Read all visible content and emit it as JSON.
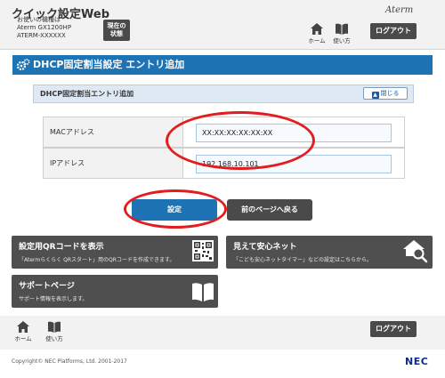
{
  "header": {
    "app_title": "クイック設定Web",
    "device_caption": "お使いの機種は",
    "device_model": "Aterm GX1200HP",
    "device_id": "ATERM-XXXXXX",
    "status_button": "現在の\n状態",
    "brand": "Aterm",
    "home_label": "ホーム",
    "help_label": "使い方",
    "logout_label": "ログアウト"
  },
  "page": {
    "title": "DHCP固定割当設定 エントリ追加"
  },
  "section": {
    "title": "DHCP固定割当エントリ追加",
    "close_label": "閉じる",
    "fields": [
      {
        "label": "MACアドレス",
        "value": "XX:XX:XX:XX:XX:XX"
      },
      {
        "label": "IPアドレス",
        "value": "192.168.10.101"
      }
    ]
  },
  "actions": {
    "set_label": "設定",
    "back_label": "前のページへ戻る"
  },
  "tiles": [
    {
      "title": "設定用QRコードを表示",
      "desc": "「Atermらくらく QRスタート」用のQRコードを作成できます。",
      "icon": "qr-code-icon"
    },
    {
      "title": "見えて安心ネット",
      "desc": "「こども安心ネットタイマー」などの設定はこちらから。",
      "icon": "house-search-icon"
    },
    {
      "title": "サポートページ",
      "desc": "サポート情報を表示します。",
      "icon": "book-icon"
    }
  ],
  "footer": {
    "home_label": "ホーム",
    "help_label": "使い方",
    "logout_label": "ログアウト",
    "copyright": "Copyright© NEC Platforms, Ltd. 2001-2017",
    "nec_logo": "NEC"
  },
  "colors": {
    "primary_blue": "#1e73b5",
    "dark_gray": "#4a4a4a",
    "annotation_red": "#e31d1d"
  }
}
